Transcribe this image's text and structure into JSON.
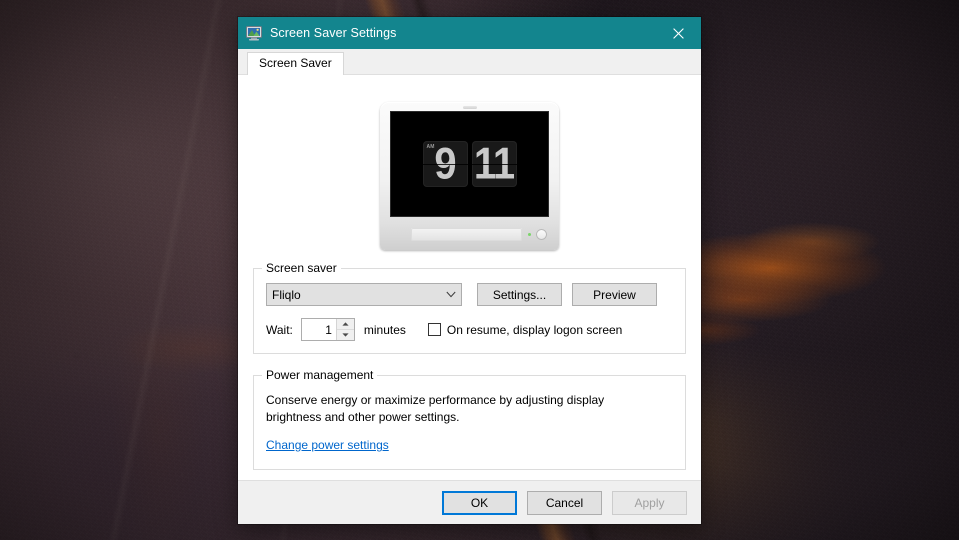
{
  "window": {
    "title": "Screen Saver Settings",
    "icon": "monitor-icon",
    "close_label": "✕",
    "titlebar_color": "#13858e"
  },
  "tabs": [
    {
      "label": "Screen Saver",
      "active": true
    }
  ],
  "preview": {
    "screensaver_name": "Fliqlo",
    "clock": {
      "hour": "9",
      "minute": "11",
      "meridiem": "AM"
    }
  },
  "screen_saver_group": {
    "title": "Screen saver",
    "dropdown": {
      "selected": "Fliqlo",
      "arrow_icon": "chevron-down-icon"
    },
    "settings_button": "Settings...",
    "preview_button": "Preview",
    "wait_label": "Wait:",
    "wait_value": "1",
    "minutes_label": "minutes",
    "logon_checkbox_label": "On resume, display logon screen",
    "logon_checkbox_checked": false
  },
  "power_group": {
    "title": "Power management",
    "description": "Conserve energy or maximize performance by adjusting display brightness and other power settings.",
    "link": "Change power settings",
    "link_color": "#0066cc"
  },
  "footer": {
    "ok": "OK",
    "cancel": "Cancel",
    "apply": "Apply",
    "apply_disabled": true,
    "focus_color": "#0078d7"
  }
}
